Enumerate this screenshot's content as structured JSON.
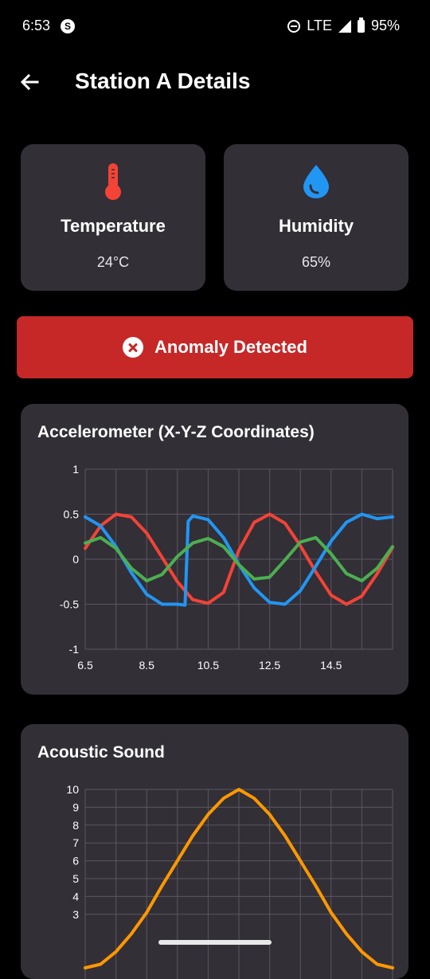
{
  "status_bar": {
    "time": "6:53",
    "network": "LTE",
    "battery": "95%"
  },
  "app_bar": {
    "title": "Station A Details"
  },
  "sensors": [
    {
      "name": "Temperature",
      "value": "24°C",
      "icon": "thermometer-icon",
      "color": "#f44336"
    },
    {
      "name": "Humidity",
      "value": "65%",
      "icon": "water-drop-icon",
      "color": "#2196f3"
    }
  ],
  "alert": {
    "text": "Anomaly Detected",
    "color": "#c62828",
    "icon": "error-circle-icon"
  },
  "chart_data": [
    {
      "type": "line",
      "title": "Accelerometer (X-Y-Z Coordinates)",
      "xlabel": "",
      "ylabel": "",
      "xlim": [
        6.5,
        16.5
      ],
      "ylim": [
        -1,
        1
      ],
      "x_ticks": [
        6.5,
        8.5,
        10.5,
        12.5,
        14.5
      ],
      "y_ticks": [
        1,
        0.5,
        0,
        -0.5,
        -1
      ],
      "grid": true,
      "series": [
        {
          "color": "#f44336",
          "x": [
            6.5,
            7.0,
            7.5,
            8.0,
            8.5,
            9.0,
            9.5,
            10.0,
            10.5,
            11.0,
            11.5,
            12.0,
            12.5,
            13.0,
            13.5,
            14.0,
            14.5,
            15.0,
            15.5,
            16.0,
            16.5
          ],
          "y": [
            0.12,
            0.37,
            0.5,
            0.47,
            0.29,
            0.02,
            -0.25,
            -0.45,
            -0.49,
            -0.37,
            0.1,
            0.41,
            0.5,
            0.4,
            0.15,
            -0.14,
            -0.4,
            -0.5,
            -0.41,
            -0.16,
            0.13
          ]
        },
        {
          "color": "#2196f3",
          "x": [
            6.5,
            7.0,
            7.5,
            8.0,
            8.5,
            9.0,
            9.5,
            9.75,
            9.85,
            10.0,
            10.5,
            11.0,
            11.5,
            12.0,
            12.5,
            13.0,
            13.5,
            14.0,
            14.5,
            15.0,
            15.5,
            16.0,
            16.5
          ],
          "y": [
            0.47,
            0.37,
            0.14,
            -0.15,
            -0.39,
            -0.5,
            -0.5,
            -0.51,
            0.42,
            0.48,
            0.44,
            0.24,
            -0.06,
            -0.32,
            -0.48,
            -0.5,
            -0.35,
            -0.08,
            0.2,
            0.41,
            0.5,
            0.45,
            0.47
          ]
        },
        {
          "color": "#4caf50",
          "x": [
            6.5,
            7.0,
            7.5,
            8.0,
            8.5,
            9.0,
            9.5,
            10.0,
            10.5,
            11.0,
            11.5,
            12.0,
            12.5,
            13.0,
            13.5,
            14.0,
            14.5,
            15.0,
            15.5,
            16.0,
            16.5
          ],
          "y": [
            0.18,
            0.24,
            0.12,
            -0.1,
            -0.24,
            -0.17,
            0.03,
            0.18,
            0.23,
            0.14,
            -0.06,
            -0.22,
            -0.2,
            -0.01,
            0.19,
            0.24,
            0.06,
            -0.16,
            -0.24,
            -0.1,
            0.14
          ]
        }
      ]
    },
    {
      "type": "line",
      "title": "Acoustic Sound",
      "xlabel": "",
      "ylabel": "",
      "ylim": [
        0,
        10
      ],
      "y_ticks": [
        10,
        9,
        8,
        7,
        6,
        5,
        4,
        3
      ],
      "grid": true,
      "series": [
        {
          "color": "#ff9800",
          "x": [
            0,
            1,
            2,
            3,
            4,
            5,
            6,
            7,
            8,
            9,
            10,
            11,
            12,
            13,
            14,
            15,
            16,
            17,
            18,
            19,
            20
          ],
          "y": [
            0.0,
            0.2,
            0.9,
            1.9,
            3.1,
            4.6,
            6.0,
            7.4,
            8.6,
            9.5,
            10.0,
            9.5,
            8.6,
            7.4,
            6.0,
            4.6,
            3.1,
            1.9,
            0.9,
            0.2,
            0.0
          ]
        }
      ]
    }
  ]
}
